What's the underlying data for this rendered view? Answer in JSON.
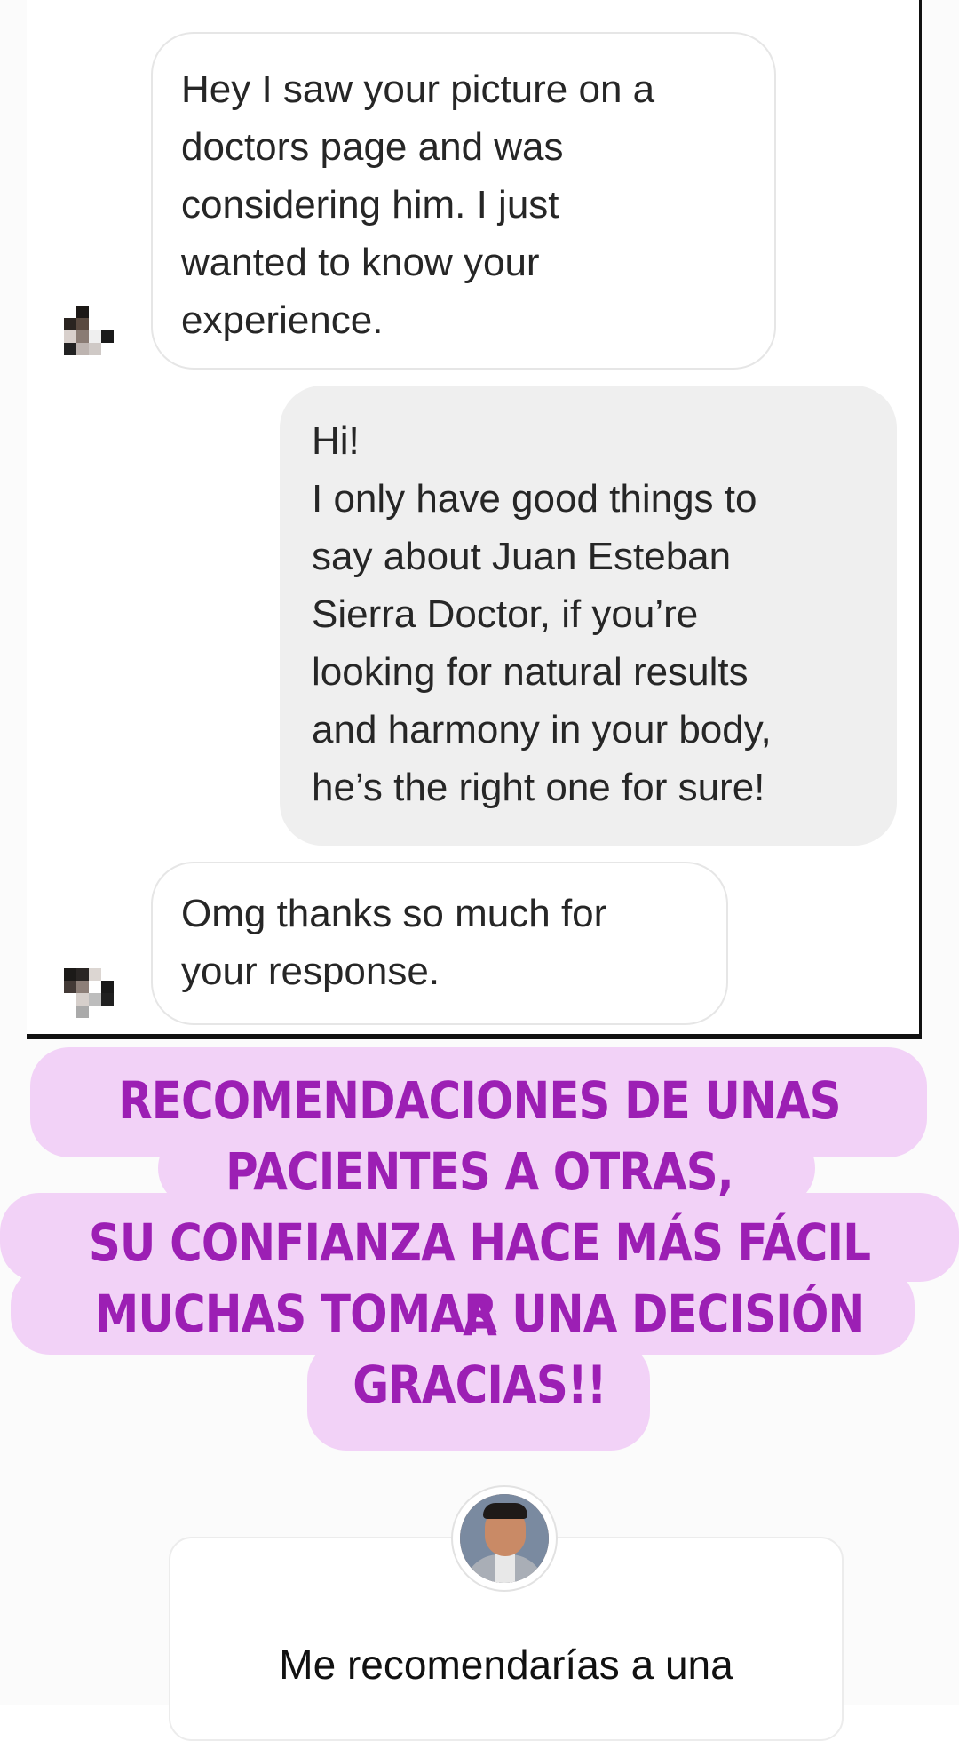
{
  "conversation": {
    "messages": [
      {
        "from": "other",
        "text": "Hey I saw your picture on a\ndoctors page and was\nconsidering him. I just\nwanted to know your\nexperience."
      },
      {
        "from": "me",
        "text": "Hi!\nI only have good things to\nsay about Juan Esteban\nSierra Doctor, if you’re\nlooking for natural results\nand harmony in your body,\nhe’s the right one for sure!"
      },
      {
        "from": "other",
        "text": "Omg thanks so much for\nyour response."
      }
    ]
  },
  "caption": {
    "lines": [
      "RECOMENDACIONES DE UNAS",
      "PACIENTES A OTRAS,",
      "SU CONFIANZA HACE MÁS FÁCIL A",
      "MUCHAS TOMAR UNA DECISIÓN",
      "GRACIAS!!"
    ],
    "text_color": "#9c1fb4",
    "highlight_color": "#f2d2f7"
  },
  "question_sticker": {
    "text": "Me recomendarías a una"
  }
}
